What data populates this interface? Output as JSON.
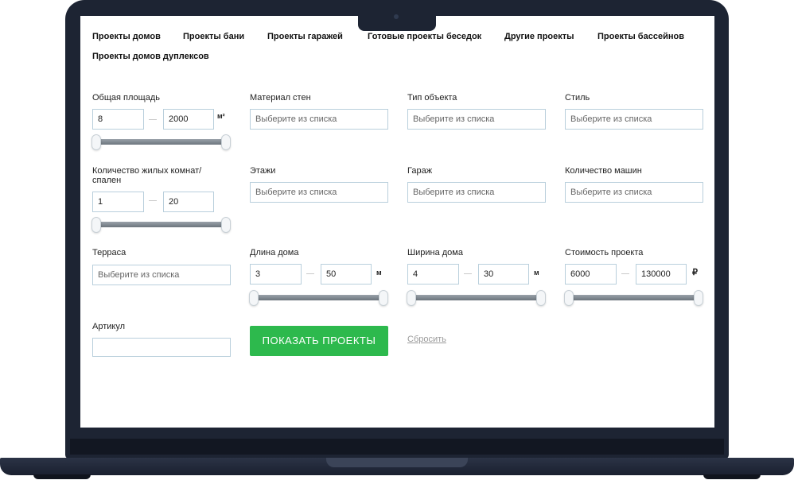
{
  "nav": {
    "tabs": [
      "Проекты домов",
      "Проекты бани",
      "Проекты гаражей",
      "Готовые проекты беседок",
      "Другие проекты",
      "Проекты бассейнов",
      "Проекты домов дуплексов"
    ]
  },
  "filters": {
    "area": {
      "label": "Общая площадь",
      "from": "8",
      "to": "2000",
      "unit": "м²"
    },
    "wall_material": {
      "label": "Материал стен",
      "placeholder": "Выберите из списка"
    },
    "object_type": {
      "label": "Тип объекта",
      "placeholder": "Выберите из списка"
    },
    "style": {
      "label": "Стиль",
      "placeholder": "Выберите из списка"
    },
    "rooms": {
      "label": "Количество жилых комнат/ спален",
      "from": "1",
      "to": "20"
    },
    "floors": {
      "label": "Этажи",
      "placeholder": "Выберите из списка"
    },
    "garage": {
      "label": "Гараж",
      "placeholder": "Выберите из списка"
    },
    "cars": {
      "label": "Количество машин",
      "placeholder": "Выберите из списка"
    },
    "terrace": {
      "label": "Терраса",
      "placeholder": "Выберите из списка"
    },
    "length": {
      "label": "Длина дома",
      "from": "3",
      "to": "50",
      "unit": "м"
    },
    "width": {
      "label": "Ширина дома",
      "from": "4",
      "to": "30",
      "unit": "м"
    },
    "cost": {
      "label": "Стоимость проекта",
      "from": "6000",
      "to": "130000",
      "unit": "₽"
    },
    "article": {
      "label": "Артикул",
      "value": ""
    }
  },
  "actions": {
    "submit_label": "ПОКАЗАТЬ ПРОЕКТЫ",
    "reset_label": "Сбросить"
  },
  "colors": {
    "accent": "#2db94d",
    "frame": "#1d2433",
    "input_border": "#b9cfdc"
  }
}
